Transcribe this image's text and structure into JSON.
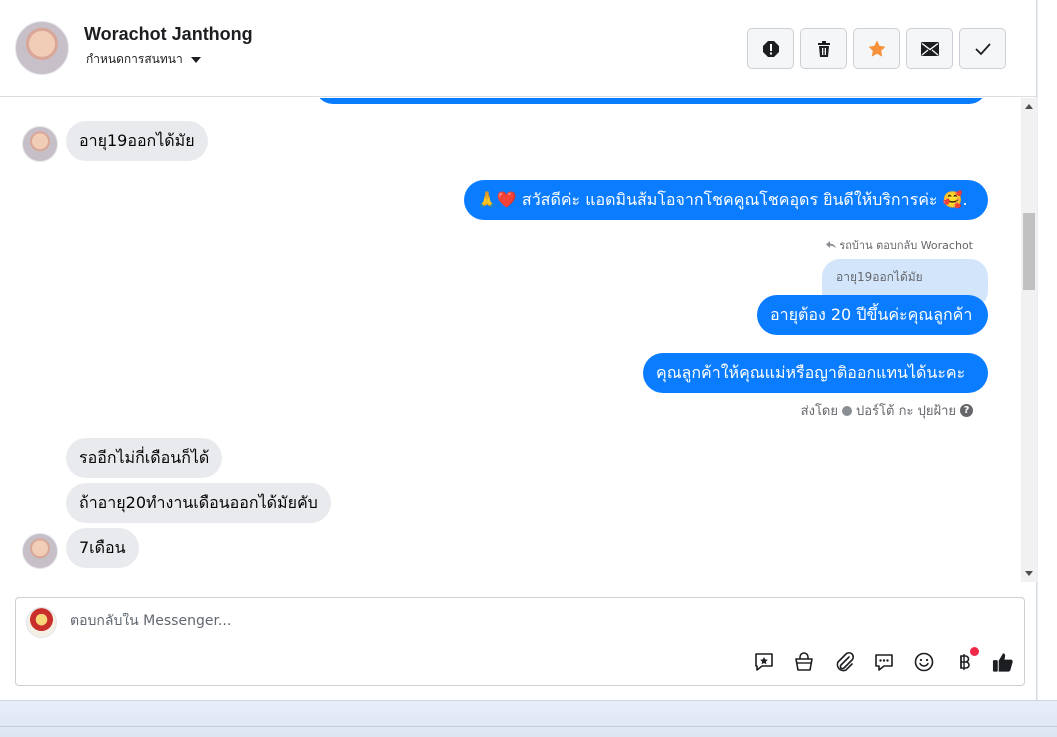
{
  "header": {
    "contact_name": "Worachot Janthong",
    "assign_label": "กำหนดการสนทนา",
    "actions": [
      "mark-spam",
      "delete",
      "star",
      "mark-unread",
      "mark-done"
    ]
  },
  "conversation": {
    "messages": [
      {
        "dir": "in",
        "text": "อายุ19ออกได้มัย"
      },
      {
        "dir": "out",
        "text": "🙏❤️ สวัสดีค่ะ แอดมินส้มโอจากโชคคูณโชคอุดร ยินดีให้บริการค่ะ 🥰."
      },
      {
        "dir": "out",
        "text": "อายุต้อง 20 ปีขึ้นค่ะคุณลูกค้า"
      },
      {
        "dir": "out",
        "text": "คุณลูกค้าให้คุณแม่หรือญาติออกแทนได้นะคะ"
      },
      {
        "dir": "in",
        "text": "รออีกไม่กี่เดือนก็ได้"
      },
      {
        "dir": "in",
        "text": "ถ้าอายุ20ทำงานเดือนออกได้มัยคับ"
      },
      {
        "dir": "in",
        "text": "7เดือน"
      }
    ],
    "reply_note": "รถบ้าน ตอบกลับ Worachot",
    "quoted_text": "อายุ19ออกได้มัย",
    "sent_by_prefix": "ส่งโดย",
    "sent_by_name": "ปอร์โต้ กะ ปุยฝ้าย"
  },
  "composer": {
    "placeholder": "ตอบกลับใน Messenger...",
    "tools": [
      "saved-reply-icon",
      "shop-bag-icon",
      "attach-icon",
      "chat-bubbles-icon",
      "emoji-icon",
      "baht-payment-icon",
      "like-icon"
    ]
  }
}
